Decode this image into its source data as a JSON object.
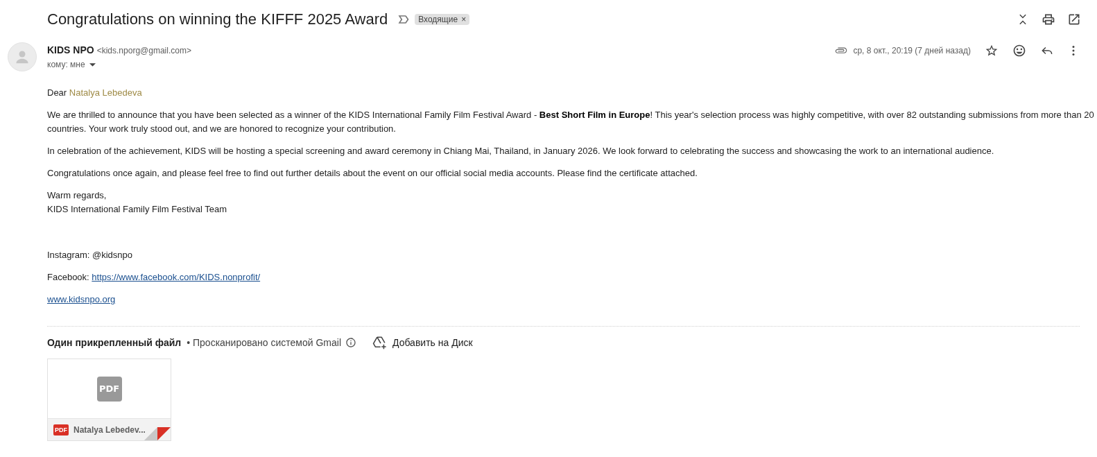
{
  "header": {
    "subject": "Congratulations on winning the KIFFF 2025 Award",
    "important": false,
    "labels": [
      {
        "name": "Входящие",
        "remove": "×"
      }
    ]
  },
  "message": {
    "sender_name": "KIDS NPO",
    "sender_email": "<kids.nporg@gmail.com>",
    "recipient": "кому: мне",
    "has_attachment": true,
    "date": "ср, 8 окт., 20:19 (7 дней назад)",
    "starred": false
  },
  "body": {
    "greeting": "Dear",
    "recipient_name": "Natalya Lebedeva",
    "paragraphs": [
      "We are thrilled to announce that you have been selected as a winner of the KIDS International Family Film Festival Award - **Best Short Film in Europe**! This year's selection process was highly competitive, with over 82 outstanding submissions from more than 20 countries. Your work truly stood out, and we are honored to recognize your contribution.",
      "In celebration of the achievement, KIDS will be hosting a special screening and award ceremony in Chiang Mai, Thailand, in January 2026. We look forward to celebrating the success and showcasing the work to an international audience.",
      "Congratulations once again, and please feel free to find out further details about the event on our official social media accounts. Please find the certificate attached."
    ],
    "signoff": [
      "Warm regards,",
      "KIDS International Family Film Festival Team"
    ],
    "contacts": [
      {
        "kind": "text",
        "text": "Instagram: @kidsnpo"
      },
      {
        "kind": "link",
        "label": "Facebook:",
        "link_text": "https://www.facebook.com/KIDS.nonprofit/"
      },
      {
        "kind": "link",
        "link_text": "www.kidsnpo.org"
      }
    ]
  },
  "attachments": {
    "title": "Один прикрепленный файл",
    "scan_note": "• Просканировано системой Gmail",
    "add_action": "Добавить на Диск",
    "files": [
      {
        "kind": "pdf",
        "preview_label": "PDF",
        "type_label": "PDF",
        "name": "Natalya Lebedev..."
      }
    ]
  }
}
